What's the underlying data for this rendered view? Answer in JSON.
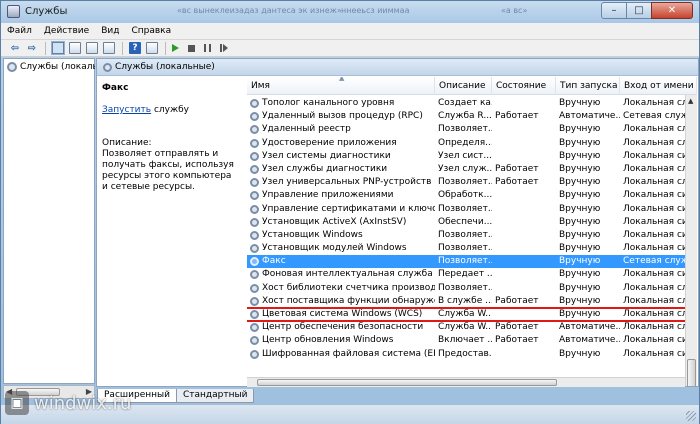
{
  "window": {
    "title": "Службы",
    "ghost_title_left": "«вс вынеклеизадаз дантеса эк изнеж»",
    "ghost_title_mid": "ннееьсз ииммаа",
    "ghost_title_right": "«а вс»",
    "minimize": "–",
    "maximize": "□",
    "close": "✕"
  },
  "menu": [
    "Файл",
    "Действие",
    "Вид",
    "Справка"
  ],
  "toolbar": {
    "back": "⇦",
    "forward": "⇨",
    "help": "?"
  },
  "tree": {
    "root_label": "Службы (локальные)"
  },
  "pane": {
    "title": "Службы (локальные)"
  },
  "description": {
    "service_name": "Факс",
    "start_link": "Запустить",
    "start_suffix": " службу",
    "label": "Описание:",
    "text": "Позволяет отправлять и получать факсы, используя ресурсы этого компьютера и сетевые ресурсы."
  },
  "columns": {
    "name": "Имя",
    "description": "Описание",
    "status": "Состояние",
    "startup": "Тип запуска",
    "logon": "Вход от имени"
  },
  "services": [
    {
      "name": "Тополог канального уровня",
      "desc": "Создает ка...",
      "status": "",
      "startup": "Вручную",
      "logon": "Локальная служба"
    },
    {
      "name": "Удаленный вызов процедур (RPC)",
      "desc": "Служба R...",
      "status": "Работает",
      "startup": "Автоматиче...",
      "logon": "Сетевая служба"
    },
    {
      "name": "Удаленный реестр",
      "desc": "Позволяет...",
      "status": "",
      "startup": "Вручную",
      "logon": "Локальная служба"
    },
    {
      "name": "Удостоверение приложения",
      "desc": "Определя...",
      "status": "",
      "startup": "Вручную",
      "logon": "Локальная служба"
    },
    {
      "name": "Узел системы диагностики",
      "desc": "Узел сист...",
      "status": "",
      "startup": "Вручную",
      "logon": "Локальная система"
    },
    {
      "name": "Узел службы диагностики",
      "desc": "Узел служ...",
      "status": "Работает",
      "startup": "Вручную",
      "logon": "Локальная служба"
    },
    {
      "name": "Узел универсальных PNP-устройств",
      "desc": "Позволяет...",
      "status": "Работает",
      "startup": "Вручную",
      "logon": "Локальная служба"
    },
    {
      "name": "Управление приложениями",
      "desc": "Обработк...",
      "status": "",
      "startup": "Вручную",
      "logon": "Локальная система"
    },
    {
      "name": "Управление сертификатами и ключом ра...",
      "desc": "Позволяет...",
      "status": "",
      "startup": "Вручную",
      "logon": "Локальная система"
    },
    {
      "name": "Установщик ActiveX (AxInstSV)",
      "desc": "Обеспечи...",
      "status": "",
      "startup": "Вручную",
      "logon": "Локальная система"
    },
    {
      "name": "Установщик Windows",
      "desc": "Позволяет...",
      "status": "",
      "startup": "Вручную",
      "logon": "Локальная система"
    },
    {
      "name": "Установщик модулей Windows",
      "desc": "Позволяет...",
      "status": "",
      "startup": "Вручную",
      "logon": "Локальная система"
    },
    {
      "name": "Факс",
      "desc": "Позволяет...",
      "status": "",
      "startup": "Вручную",
      "logon": "Сетевая служба"
    },
    {
      "name": "Фоновая интеллектуальная служба переда...",
      "desc": "Передает ...",
      "status": "",
      "startup": "Вручную",
      "logon": "Локальная система"
    },
    {
      "name": "Хост библиотеки счетчика производитель...",
      "desc": "Позволяет...",
      "status": "",
      "startup": "Вручную",
      "logon": "Локальная служба"
    },
    {
      "name": "Хост поставщика функции обнаружения",
      "desc": "В службе ...",
      "status": "Работает",
      "startup": "Вручную",
      "logon": "Локальная служба"
    },
    {
      "name": "Цветовая система Windows (WCS)",
      "desc": "Служба W...",
      "status": "",
      "startup": "Вручную",
      "logon": "Локальная служба"
    },
    {
      "name": "Центр обеспечения безопасности",
      "desc": "Служба W...",
      "status": "Работает",
      "startup": "Автоматиче...",
      "logon": "Локальная служба"
    },
    {
      "name": "Центр обновления Windows",
      "desc": "Включает ...",
      "status": "Работает",
      "startup": "Автоматиче...",
      "logon": "Локальная система"
    },
    {
      "name": "Шифрованная файловая система (EFS)",
      "desc": "Предостав...",
      "status": "",
      "startup": "Вручную",
      "logon": "Локальная система"
    }
  ],
  "tabs": [
    "Расширенный",
    "Стандартный"
  ],
  "watermark": "windwix.ru"
}
